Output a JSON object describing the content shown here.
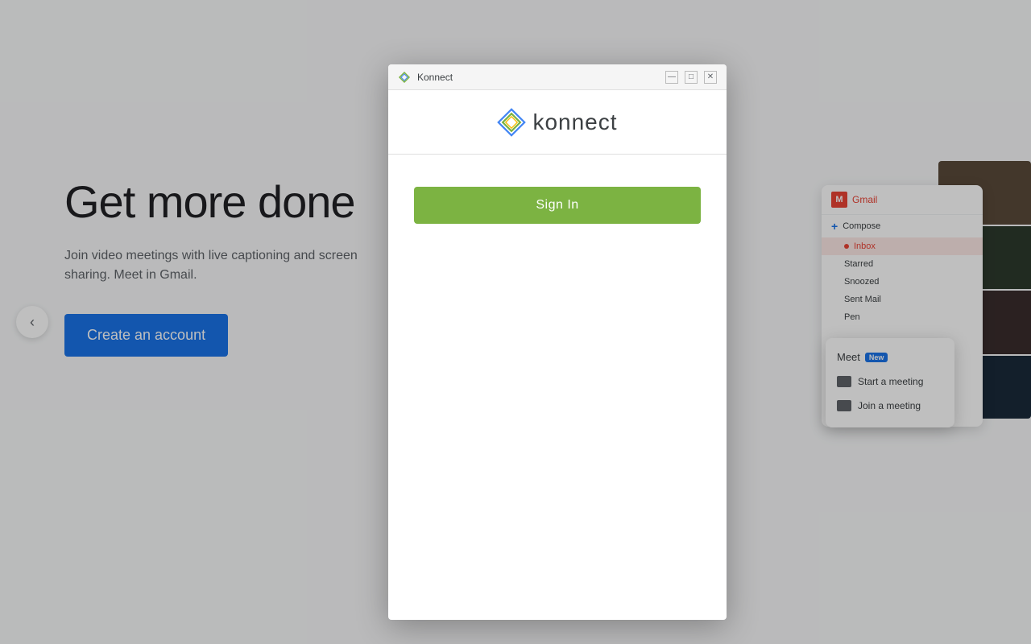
{
  "background": {
    "hero_title": "Get more done",
    "hero_subtitle": "Join video meetings with live captioning and screen sharing. Meet in Gmail.",
    "create_account_label": "Create an account",
    "bg_color": "#f8f9fa"
  },
  "modal": {
    "title": "Konnect",
    "logo_text": "konnect",
    "sign_in_label": "Sign In",
    "window_controls": {
      "minimize": "—",
      "maximize": "□",
      "close": "✕"
    }
  },
  "carousel": {
    "dots": [
      {
        "id": 1,
        "active": true
      },
      {
        "id": 2,
        "active": false
      },
      {
        "id": 3,
        "active": false
      }
    ]
  },
  "gmail_panel": {
    "app_name": "Gmail",
    "compose_label": "Compose",
    "nav_items": [
      {
        "label": "Inbox",
        "active": true
      },
      {
        "label": "Starred",
        "active": false
      },
      {
        "label": "Snoozed",
        "active": false
      },
      {
        "label": "Sent Mail",
        "active": false
      },
      {
        "label": "Pen",
        "active": false
      }
    ]
  },
  "meet_popup": {
    "title": "Meet",
    "badge": "New",
    "items": [
      {
        "label": "Start a meeting"
      },
      {
        "label": "Join a meeting"
      }
    ]
  }
}
